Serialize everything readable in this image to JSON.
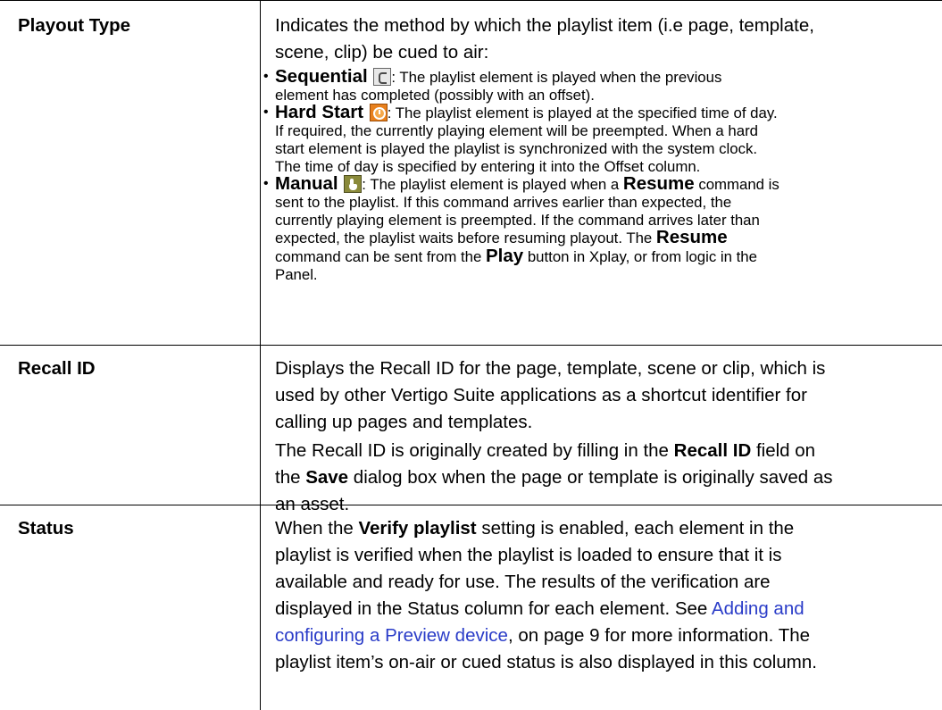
{
  "rows": [
    {
      "label": "Playout Type",
      "intro_line1": "Indicates the method by which the playlist item (i.e page, template,",
      "intro_line2": "scene, clip) be cued to air:",
      "bullets": [
        {
          "term": "Sequential",
          "icon": "sequential-icon",
          "line1_rest": ": The playlist element is played when the previous",
          "line2": "element has completed (possibly with an offset)."
        },
        {
          "term": "Hard Start",
          "icon": "hard-start-clock-icon",
          "line1_rest": ": The playlist element is played at the specified time of day.",
          "line2": "If required, the currently playing element will be preempted. When a hard",
          "line3": "start element is played the playlist is synchronized with the system clock.",
          "line4": "The time of day is specified by entering it into the Offset column."
        },
        {
          "term": "Manual",
          "icon": "manual-hand-icon",
          "line1_a": ": The playlist element is played when a ",
          "line1_bold": "Resume",
          "line1_b": " command is",
          "line2": "sent to the playlist. If this command arrives earlier than expected, the",
          "line3": "currently playing element is preempted. If the command arrives later than",
          "line4_a": "expected, the playlist waits before resuming playout. The ",
          "line4_bold": "Resume",
          "line5_a": "command can be sent from the ",
          "line5_bold": "Play",
          "line5_b": " button in Xplay, or from logic in the",
          "line6": "Panel."
        }
      ]
    },
    {
      "label": "Recall ID",
      "p1_line1": "Displays the Recall ID for the page, template, scene or clip, which is",
      "p1_line2": "used by other Vertigo Suite applications as a shortcut identifier for",
      "p1_line3": "calling up pages and templates.",
      "p2_line1_a": "The Recall ID is originally created by filling in the ",
      "p2_line1_bold": "Recall ID",
      "p2_line1_b": " field on",
      "p2_line2_a": "the ",
      "p2_line2_bold": "Save",
      "p2_line2_b": " dialog box when the page or template is originally saved as",
      "p2_line3": "an asset."
    },
    {
      "label": "Status",
      "line1_a": "When the ",
      "line1_bold": "Verify playlist",
      "line1_b": " setting is enabled, each element in the",
      "line2": "playlist is verified when the playlist is loaded to ensure that it is",
      "line3": "available and ready for use. The results of the verification are",
      "line4_a": "displayed in the Status column for each element. See ",
      "line4_link": "Adding and",
      "line5_link": "configuring a Preview device",
      "line5_b": ", on page 9 for more information. The",
      "line6": "playlist item’s on-air or cued status is also displayed in this column."
    }
  ],
  "colors": {
    "link": "#2a3cc8",
    "border": "#000000"
  }
}
